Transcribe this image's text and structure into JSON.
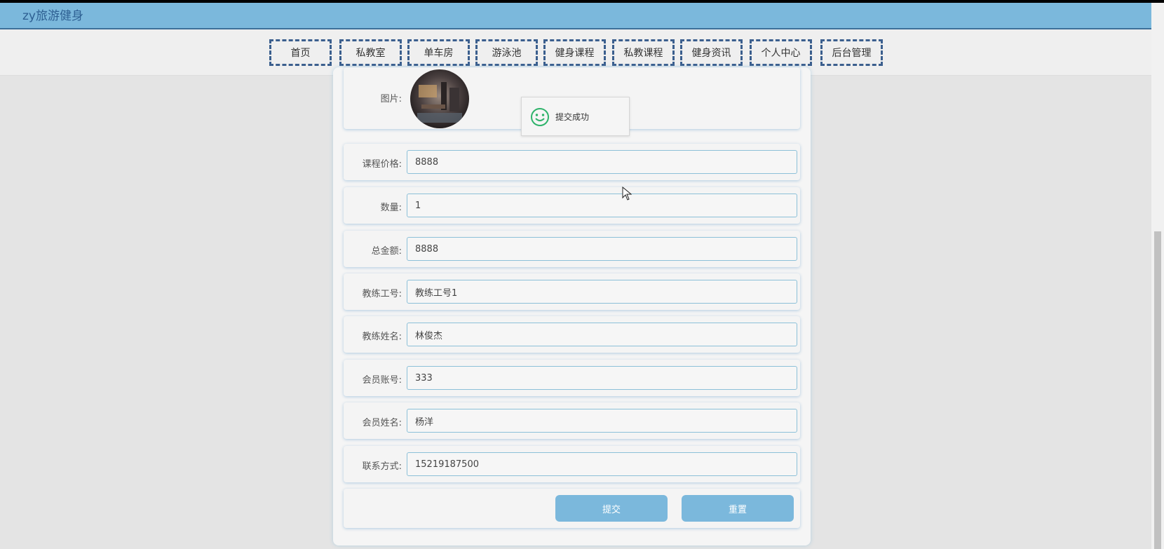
{
  "header": {
    "brand": "zy旅游健身"
  },
  "nav": {
    "items": [
      "首页",
      "私教室",
      "单车房",
      "游泳池",
      "健身课程",
      "私教课程",
      "健身资讯",
      "个人中心",
      "后台管理"
    ]
  },
  "form": {
    "image_label": "图片:",
    "fields": [
      {
        "label": "课程价格:",
        "value": "8888"
      },
      {
        "label": "数量:",
        "value": "1"
      },
      {
        "label": "总金额:",
        "value": "8888"
      },
      {
        "label": "教练工号:",
        "value": "教练工号1"
      },
      {
        "label": "教练姓名:",
        "value": "林俊杰"
      },
      {
        "label": "会员账号:",
        "value": "333"
      },
      {
        "label": "会员姓名:",
        "value": "杨洋"
      },
      {
        "label": "联系方式:",
        "value": "15219187500"
      }
    ],
    "submit_label": "提交",
    "reset_label": "重置"
  },
  "toast": {
    "message": "提交成功",
    "icon": "smile-icon"
  },
  "colors": {
    "header_bg": "#7bb8dc",
    "brand_text": "#2d5f92",
    "nav_border": "#3b5f8e",
    "button_bg": "#7bb8dc",
    "toast_icon": "#2fb36b"
  }
}
